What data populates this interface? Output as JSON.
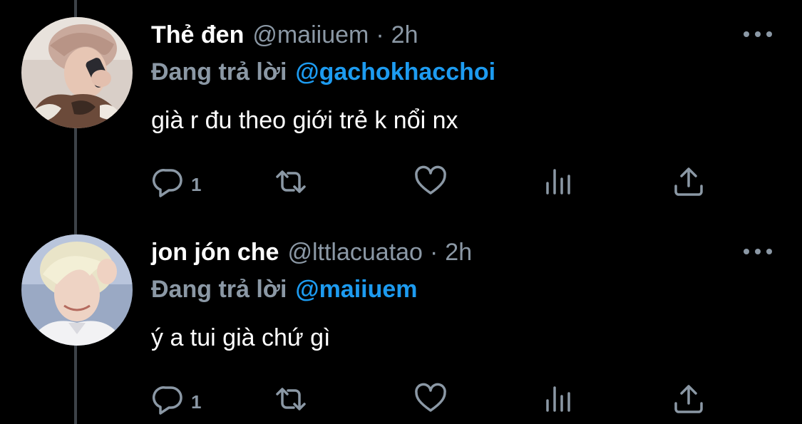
{
  "tweets": [
    {
      "display_name": "Thẻ đen",
      "handle": "@maiiuem",
      "separator": "·",
      "time": "2h",
      "reply_prefix": "Đang trả lời",
      "reply_to": "@gachokhacchoi",
      "text": "già r đu theo giới trẻ k nổi nx",
      "reply_count": "1",
      "avatar_icon": "avatar-photo"
    },
    {
      "display_name": "jon jón che",
      "handle": "@lttlacuatao",
      "separator": "·",
      "time": "2h",
      "reply_prefix": "Đang trả lời",
      "reply_to": "@maiiuem",
      "text": "ý a tui già chứ gì",
      "reply_count": "1",
      "avatar_icon": "avatar-photo"
    }
  ],
  "icons": {
    "reply": "reply-icon",
    "retweet": "retweet-icon",
    "like": "heart-icon",
    "analytics": "analytics-icon",
    "share": "share-icon",
    "more": "more-icon"
  },
  "colors": {
    "background": "#000000",
    "text": "#ffffff",
    "secondary": "#8b98a5",
    "accent": "#1d9bf0",
    "thread_line": "#3d4248"
  }
}
